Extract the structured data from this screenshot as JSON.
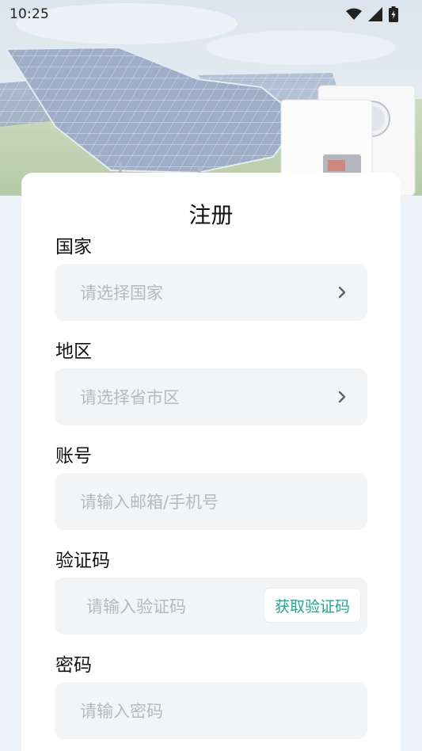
{
  "status_bar": {
    "time": "10:25",
    "icons": [
      "wifi-icon",
      "signal-icon",
      "battery-charging-icon"
    ]
  },
  "form": {
    "title": "注册",
    "country": {
      "label": "国家",
      "placeholder": "请选择国家"
    },
    "region": {
      "label": "地区",
      "placeholder": "请选择省市区"
    },
    "account": {
      "label": "账号",
      "placeholder": "请输入邮箱/手机号"
    },
    "code": {
      "label": "验证码",
      "placeholder": "请输入验证码",
      "button_label": "获取验证码"
    },
    "password": {
      "label": "密码",
      "placeholder": "请输入密码"
    }
  },
  "colors": {
    "accent": "#1ea890",
    "field_bg": "#f3f4f6",
    "page_bg": "#eef3f8",
    "placeholder": "#b6b9bf"
  }
}
